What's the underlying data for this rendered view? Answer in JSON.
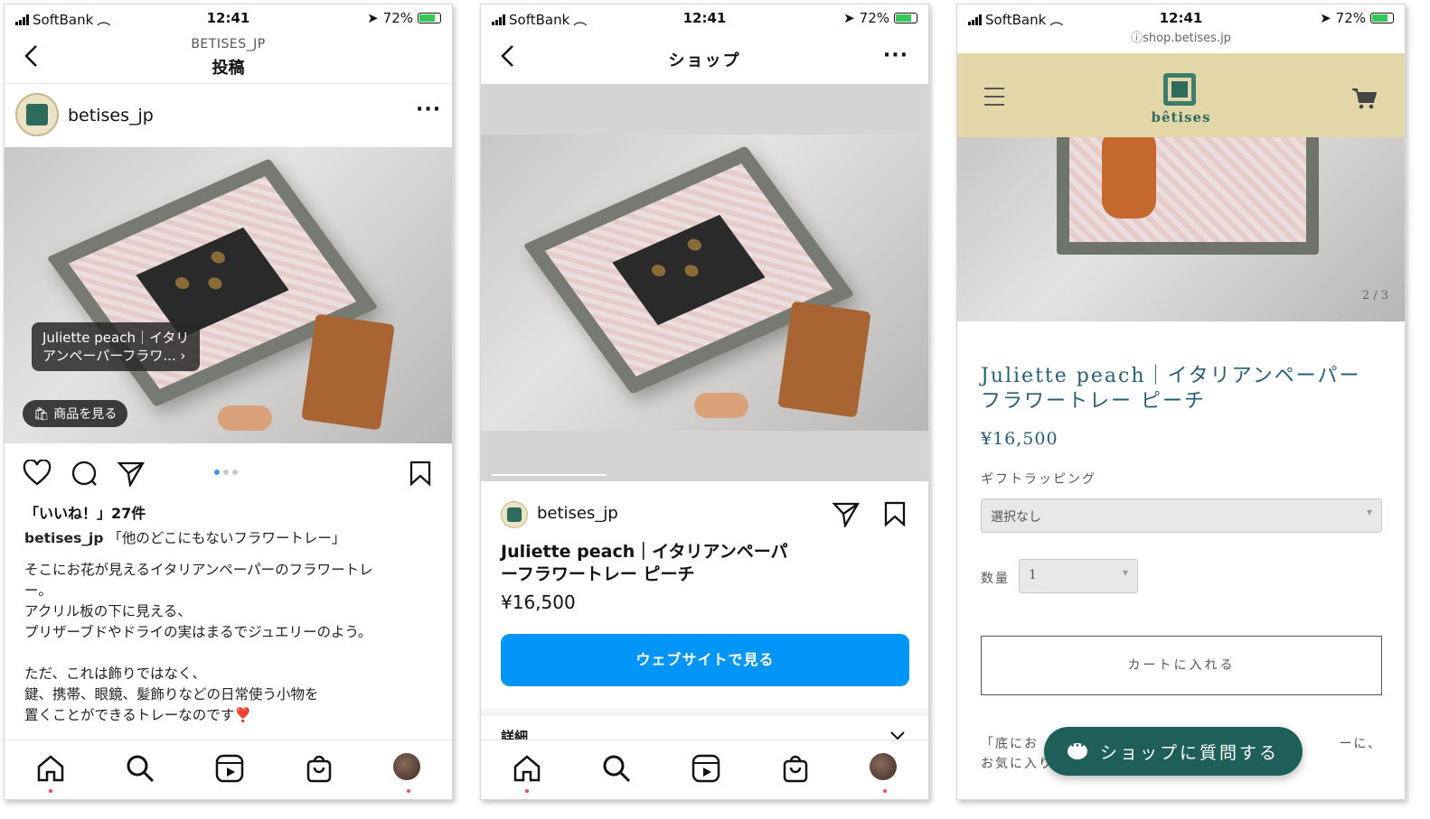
{
  "status": {
    "carrier": "SoftBank",
    "time": "12:41",
    "battery": "72%"
  },
  "post": {
    "header_sub": "BETISES_JP",
    "header_title": "投稿",
    "username": "betises_jp",
    "product_tag_line1": "Juliette peach｜イタリ",
    "product_tag_line2": "アンペーパーフラワ... ›",
    "shop_button": "商品を見る",
    "likes": "「いいね！」27件",
    "caption_user": "betises_jp",
    "caption_head": "「他のどこにもないフラワートレー」",
    "caption_lines": [
      "そこにお花が見えるイタリアンペーパーのフラワートレ",
      "ー。",
      "アクリル板の下に見える、",
      "プリザーブドやドライの実はまるでジュエリーのよう。",
      "",
      "ただ、これは飾りではなく、",
      "鍵、携帯、眼鏡、髪飾りなどの日常使う小物を",
      "置くことができるトレーなのです❣️"
    ]
  },
  "shop": {
    "title": "ショップ",
    "username": "betises_jp",
    "product_title_line1": "Juliette peach｜イタリアンペーパ",
    "product_title_line2": "ーフラワートレー ピーチ",
    "price": "¥16,500",
    "website_button": "ウェブサイトで見る",
    "details_label": "詳細"
  },
  "site": {
    "url": "shop.betises.jp",
    "brand": "bêtises",
    "image_counter": "2 / 3",
    "product_title_line1": "Juliette peach｜イタリアンペーパー",
    "product_title_line2": "フラワートレー ピーチ",
    "price": "¥16,500",
    "gift_label": "ギフトラッピング",
    "gift_value": "選択なし",
    "qty_label": "数量",
    "qty_value": "1",
    "cart_button": "カートに入れる",
    "desc_line1_start": "「底にお",
    "desc_line1_end": "ーに、",
    "desc_line2_start": "お気に入り",
    "chat_button": "ショップに質問する"
  },
  "colors": {
    "ig_blue": "#0095f6",
    "site_header": "#e3d6a9",
    "site_teal": "#1f5f5a",
    "notify_red": "#ed4956"
  }
}
